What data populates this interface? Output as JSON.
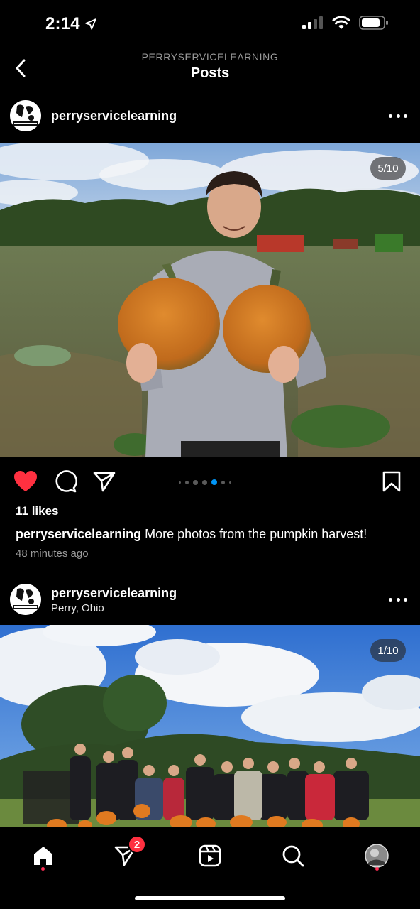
{
  "status_bar": {
    "time": "2:14"
  },
  "header": {
    "subtitle": "PERRYSERVICELEARNING",
    "title": "Posts"
  },
  "posts": [
    {
      "username": "perryservicelearning",
      "location": "",
      "image_counter": "5/10",
      "likes": "11 likes",
      "caption_username": "perryservicelearning",
      "caption_text": " More photos from the pumpkin harvest!",
      "time_ago": "48 minutes ago",
      "liked": true,
      "carousel_active_index": 3,
      "carousel_dot_count": 6
    },
    {
      "username": "perryservicelearning",
      "location": "Perry, Ohio",
      "image_counter": "1/10"
    }
  ],
  "tab_bar": {
    "dm_badge": "2"
  },
  "icons": {
    "back": "chevron-left-icon",
    "like": "heart-icon",
    "comment": "comment-icon",
    "share": "paper-plane-icon",
    "save": "bookmark-icon",
    "home": "home-icon",
    "direct": "direct-message-icon",
    "reels": "reels-icon",
    "search": "search-icon",
    "profile": "profile-avatar"
  },
  "colors": {
    "like_red": "#ff3040",
    "carousel_active": "#0095f6",
    "background": "#000000"
  }
}
